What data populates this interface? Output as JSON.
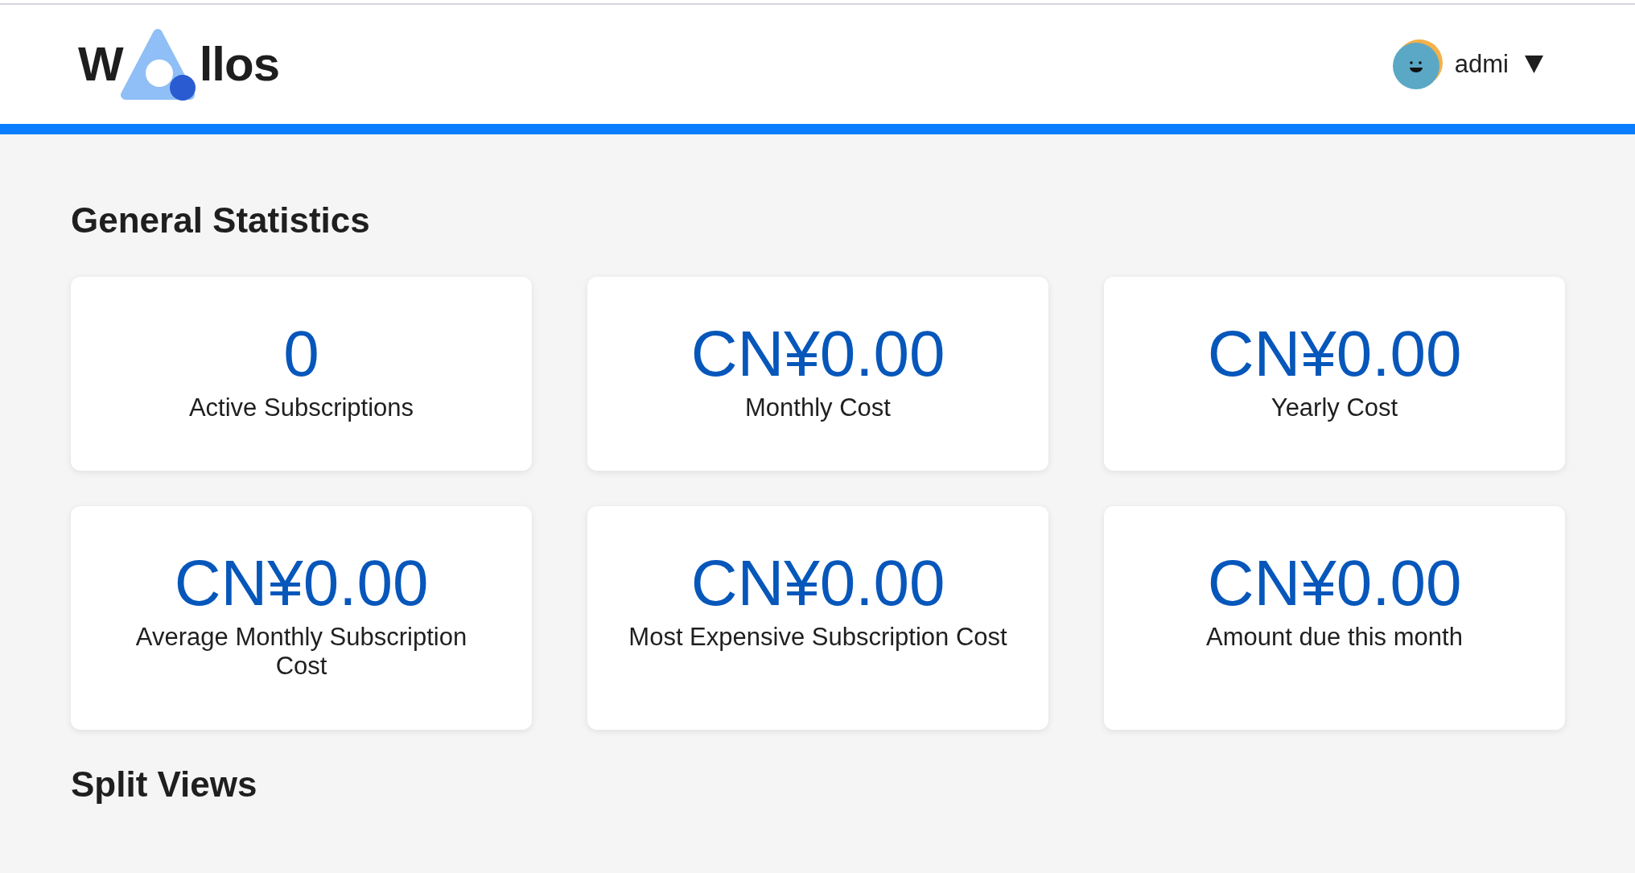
{
  "header": {
    "logo": {
      "text_start": "W",
      "text_end": "llos"
    },
    "user": {
      "name": "admi"
    }
  },
  "sections": [
    {
      "title": "General Statistics",
      "stats": [
        {
          "value": "0",
          "label": "Active Subscriptions"
        },
        {
          "value": "CN¥0.00",
          "label": "Monthly Cost"
        },
        {
          "value": "CN¥0.00",
          "label": "Yearly Cost"
        },
        {
          "value": "CN¥0.00",
          "label": "Average Monthly Subscription Cost"
        },
        {
          "value": "CN¥0.00",
          "label": "Most Expensive Subscription Cost"
        },
        {
          "value": "CN¥0.00",
          "label": "Amount due this month"
        }
      ]
    },
    {
      "title": "Split Views"
    }
  ]
}
